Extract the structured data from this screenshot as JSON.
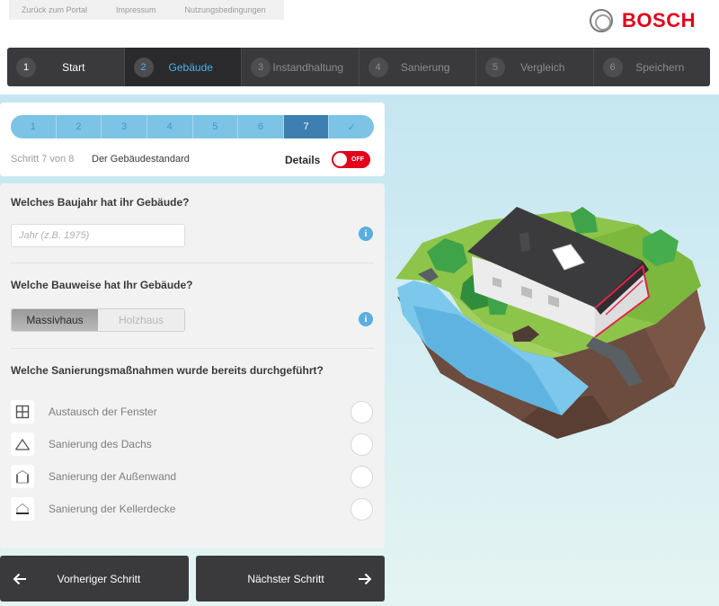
{
  "toplinks": [
    "Zurück zum Portal",
    "Impressum",
    "Nutzungsbedingungen"
  ],
  "brand": "BOSCH",
  "mainnav": [
    {
      "num": "1",
      "label": "Start"
    },
    {
      "num": "2",
      "label": "Gebäude"
    },
    {
      "num": "3",
      "label": "Instandhaltung"
    },
    {
      "num": "4",
      "label": "Sanierung"
    },
    {
      "num": "5",
      "label": "Vergleich"
    },
    {
      "num": "6",
      "label": "Speichern"
    }
  ],
  "substeps": [
    "1",
    "2",
    "3",
    "4",
    "5",
    "6",
    "7",
    "✓"
  ],
  "step_info": "Schritt 7 von 8",
  "step_name": "Der Gebäudestandard",
  "details": {
    "label": "Details",
    "toggle": "OFF"
  },
  "questions": {
    "year": "Welches Baujahr hat ihr Gebäude?",
    "year_placeholder": "Jahr (z.B. 1975)",
    "construction": "Welche Bauweise hat Ihr Gebäude?",
    "construction_options": [
      "Massivhaus",
      "Holzhaus"
    ],
    "measures": "Welche Sanierungsmaßnahmen wurde bereits durchgeführt?"
  },
  "measures": [
    {
      "icon": "window-icon",
      "label": "Austausch der Fenster"
    },
    {
      "icon": "roof-icon",
      "label": "Sanierung des Dachs"
    },
    {
      "icon": "wall-icon",
      "label": "Sanierung der Außenwand"
    },
    {
      "icon": "basement-icon",
      "label": "Sanierung der Kellerdecke"
    }
  ],
  "info_glyph": "i",
  "buttons": {
    "prev": "Vorheriger Schritt",
    "next": "Nächster Schritt"
  },
  "colors": {
    "brand_red": "#e2001a",
    "accent_blue": "#4cb3e8",
    "nav_dark": "#3a3a3c"
  }
}
